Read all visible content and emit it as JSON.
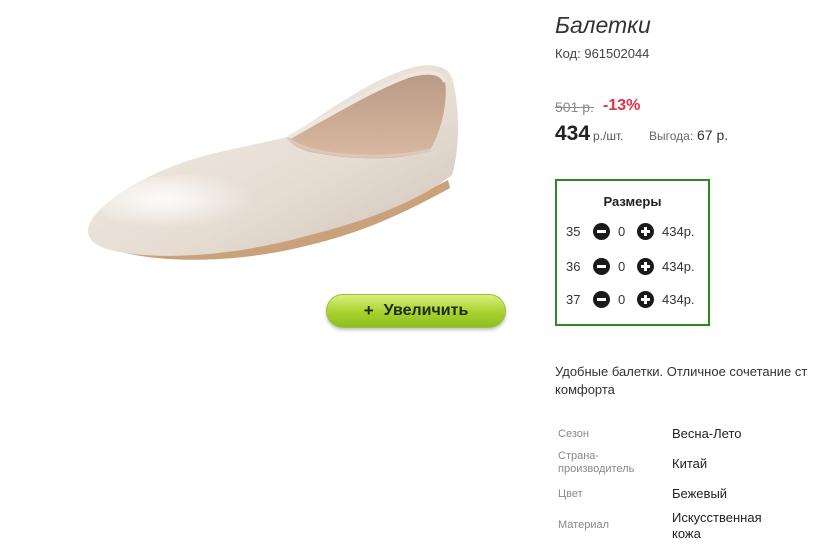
{
  "product": {
    "title": "Балетки",
    "code_label": "Код:",
    "code_value": "961502044",
    "old_price": "501 р.",
    "discount": "-13%",
    "price": "434",
    "price_unit": "р./шт.",
    "benefit_label": "Выгода:",
    "benefit_value": "67 р.",
    "description_line1": "Удобные балетки. Отличное сочетание ст",
    "description_line2": "комфорта"
  },
  "zoom_button": {
    "icon": "+",
    "label": "Увеличить"
  },
  "sizes": {
    "title": "Размеры",
    "rows": [
      {
        "size": "35",
        "qty": "0",
        "price": "434р."
      },
      {
        "size": "36",
        "qty": "0",
        "price": "434р."
      },
      {
        "size": "37",
        "qty": "0",
        "price": "434р."
      }
    ]
  },
  "attributes": [
    {
      "label_lines": [
        "Сезон"
      ],
      "value_lines": [
        "Весна-Лето"
      ]
    },
    {
      "label_lines": [
        "Страна-",
        "производитель"
      ],
      "value_lines": [
        "Китай"
      ]
    },
    {
      "label_lines": [
        "Цвет"
      ],
      "value_lines": [
        "Бежевый"
      ]
    },
    {
      "label_lines": [
        "Материал"
      ],
      "value_lines": [
        "Искусственная",
        "кожа"
      ]
    }
  ],
  "colors": {
    "discount": "#e0304a",
    "sizes_border": "#2a8a1e",
    "zoom_button": "#a8d02e"
  }
}
